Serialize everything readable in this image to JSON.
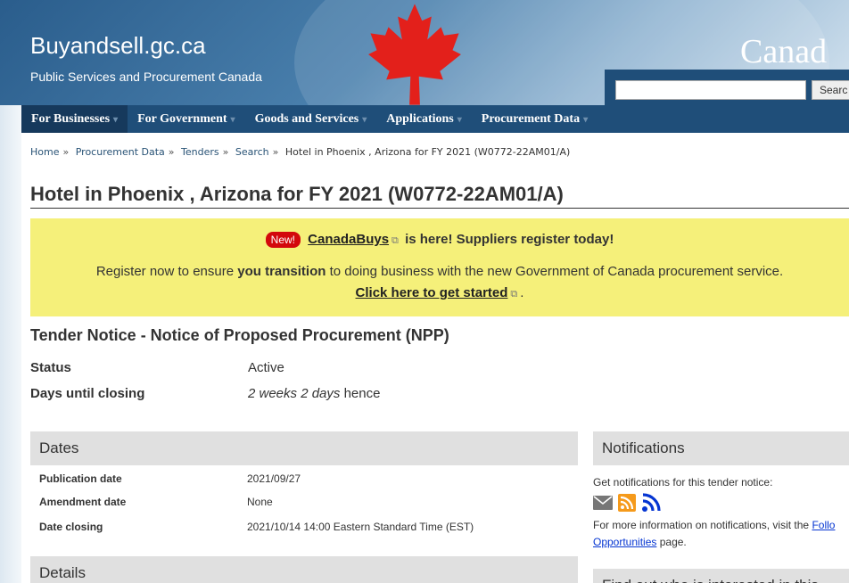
{
  "header": {
    "site_title": "Buyandsell.gc.ca",
    "site_subtitle": "Public Services and Procurement Canada",
    "wordmark": "Canad",
    "search_button": "Searc"
  },
  "nav": {
    "items": [
      {
        "label": "For Businesses"
      },
      {
        "label": "For Government"
      },
      {
        "label": "Goods and Services"
      },
      {
        "label": "Applications"
      },
      {
        "label": "Procurement Data"
      }
    ]
  },
  "breadcrumb": {
    "items": [
      "Home",
      "Procurement Data",
      "Tenders",
      "Search"
    ],
    "current": "Hotel in Phoenix , Arizona for FY 2021 (W0772-22AM01/A)"
  },
  "page_title": "Hotel in Phoenix , Arizona for FY 2021 (W0772-22AM01/A)",
  "notice": {
    "badge": "New!",
    "link": "CanadaBuys",
    "line1_rest": "is here! Suppliers register today!",
    "line2_a": "Register now to ensure",
    "line2_bold": "you transition",
    "line2_b": "to doing business with the new Government of Canada procurement service.",
    "cta": "Click here to get started",
    "cta_end": "."
  },
  "tender": {
    "heading": "Tender Notice - Notice of Proposed Procurement (NPP)",
    "status_label": "Status",
    "status_value": "Active",
    "days_label": "Days until closing",
    "days_value_em": "2 weeks 2 days",
    "days_value_rest": "hence"
  },
  "dates": {
    "heading": "Dates",
    "publication_label": "Publication date",
    "publication_value": "2021/09/27",
    "amendment_label": "Amendment date",
    "amendment_value": "None",
    "closing_label": "Date closing",
    "closing_value": "2021/10/14 14:00 Eastern Standard Time (EST)"
  },
  "details": {
    "heading": "Details"
  },
  "notifications": {
    "heading": "Notifications",
    "intro": "Get notifications for this tender notice:",
    "more_a": "For more information on notifications, visit the",
    "more_link_a": "Follo",
    "more_link_b": "Opportunities",
    "more_b": "page."
  },
  "interest": {
    "heading": "Find out who is interested in this"
  },
  "colors": {
    "nav": "#1f4e79",
    "notice_bg": "#f5f07a",
    "link": "#0535d2",
    "badge": "#d3080c",
    "rss": "#f59a1b",
    "rss_alt": "#0535d2"
  }
}
